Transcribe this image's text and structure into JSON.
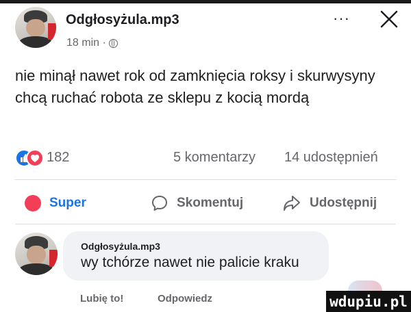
{
  "post": {
    "author": "Odgłosyżula.mp3",
    "time": "18 min ·",
    "text": "nie minął nawet rok od zamknięcia roksy i skurwysyny chcą ruchać robota ze sklepu z kocią mordą",
    "reactions_count": "182",
    "comments_count": "5 komentarzy",
    "shares_count": "14 udostępnień"
  },
  "header": {
    "more_label": "···"
  },
  "actions": {
    "super_label": "Super",
    "comment_label": "Skomentuj",
    "share_label": "Udostępnij"
  },
  "comment": {
    "author": "Odgłosyżula.mp3",
    "text": "wy tchórze nawet nie palicie kraku",
    "like_label": "Lubię to!",
    "reply_label": "Odpowiedz"
  },
  "watermark": {
    "text": "wdupiu.pl"
  },
  "icons": {
    "more": "more-options-icon",
    "close": "close-icon",
    "audience": "globe-icon",
    "like_reaction": "like-reaction-icon",
    "love_reaction": "love-reaction-icon",
    "super": "super-reaction-icon",
    "comment": "comment-bubble-icon",
    "share": "share-arrow-icon"
  },
  "colors": {
    "brand_blue": "#1b74e4",
    "reaction_red": "#f33e58",
    "secondary_text": "#65676b"
  }
}
